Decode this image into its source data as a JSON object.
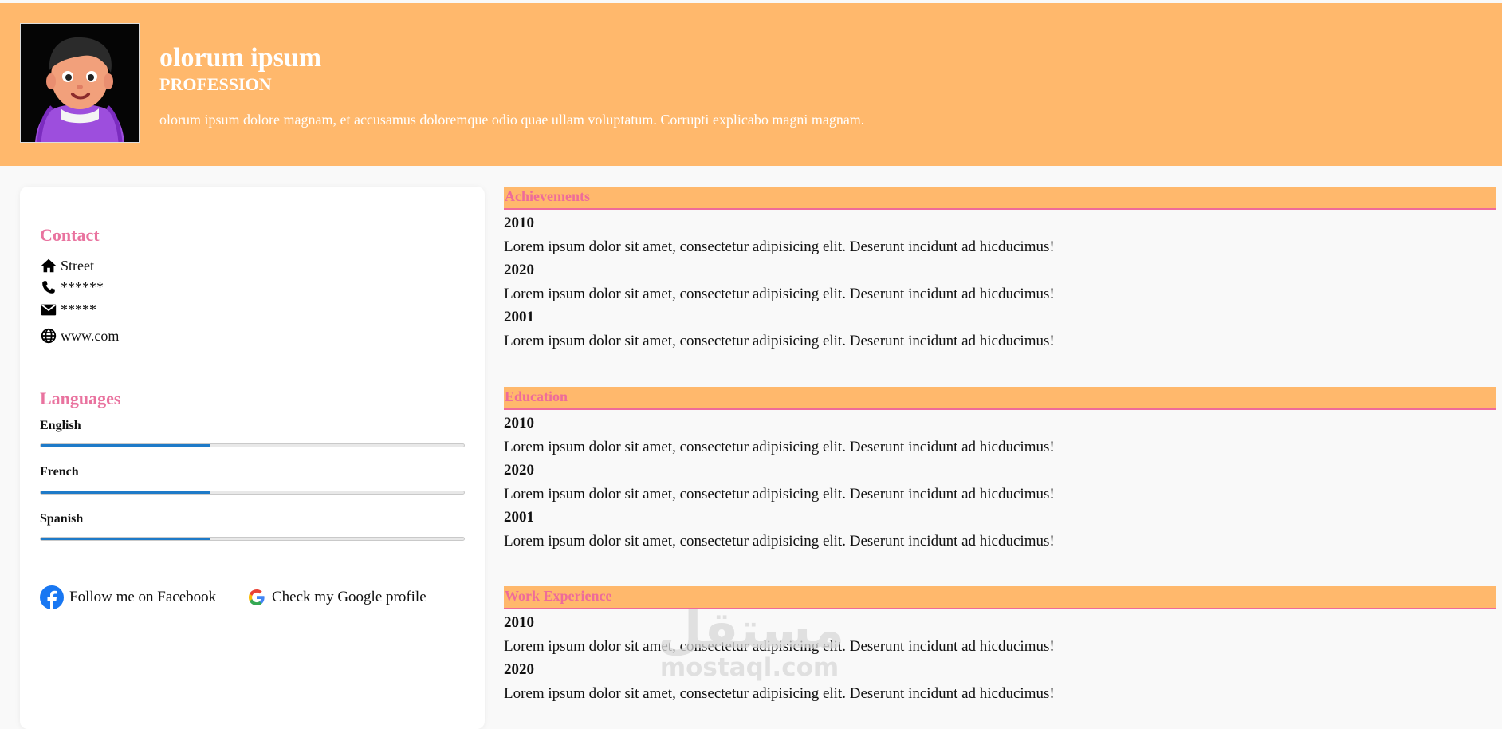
{
  "header": {
    "name": "olorum ipsum",
    "profession": "PROFESSION",
    "summary": "olorum ipsum dolore magnam, et accusamus doloremque odio quae ullam voluptatum. Corrupti explicabo magni magnam."
  },
  "sidebar": {
    "contact_title": "Contact",
    "contact": [
      {
        "icon": "home-icon",
        "text": "Street"
      },
      {
        "icon": "phone-icon",
        "text": "******"
      },
      {
        "icon": "envelope-icon",
        "text": "*****"
      },
      {
        "icon": "globe-icon",
        "text": "www.com"
      }
    ],
    "languages_title": "Languages",
    "languages": [
      {
        "name": "English",
        "level": 0.4
      },
      {
        "name": "French",
        "level": 0.4
      },
      {
        "name": "Spanish",
        "level": 0.4
      }
    ],
    "social": [
      {
        "icon": "facebook-icon",
        "label": "Follow me on Facebook"
      },
      {
        "icon": "google-icon",
        "label": "Check my Google profile"
      }
    ]
  },
  "main": {
    "sections": [
      {
        "title": "Achievements",
        "entries": [
          {
            "year": "2010",
            "text": "Lorem ipsum dolor sit amet, consectetur adipisicing elit. Deserunt incidunt ad hicducimus!"
          },
          {
            "year": "2020",
            "text": "Lorem ipsum dolor sit amet, consectetur adipisicing elit. Deserunt incidunt ad hicducimus!"
          },
          {
            "year": "2001",
            "text": "Lorem ipsum dolor sit amet, consectetur adipisicing elit. Deserunt incidunt ad hicducimus!"
          }
        ]
      },
      {
        "title": "Education",
        "entries": [
          {
            "year": "2010",
            "text": "Lorem ipsum dolor sit amet, consectetur adipisicing elit. Deserunt incidunt ad hicducimus!"
          },
          {
            "year": "2020",
            "text": "Lorem ipsum dolor sit amet, consectetur adipisicing elit. Deserunt incidunt ad hicducimus!"
          },
          {
            "year": "2001",
            "text": "Lorem ipsum dolor sit amet, consectetur adipisicing elit. Deserunt incidunt ad hicducimus!"
          }
        ]
      },
      {
        "title": "Work Experience",
        "entries": [
          {
            "year": "2010",
            "text": "Lorem ipsum dolor sit amet, consectetur adipisicing elit. Deserunt incidunt ad hicducimus!"
          },
          {
            "year": "2020",
            "text": "Lorem ipsum dolor sit amet, consectetur adipisicing elit. Deserunt incidunt ad hicducimus!"
          }
        ]
      }
    ]
  },
  "watermark": {
    "arabic": "مستقل",
    "latin": "mostaql.com"
  },
  "colors": {
    "header_bg": "#ffb86c",
    "accent_pink": "#ee6b9a",
    "progress_blue": "#1e7ac8",
    "page_bg": "#f9f9f9"
  }
}
